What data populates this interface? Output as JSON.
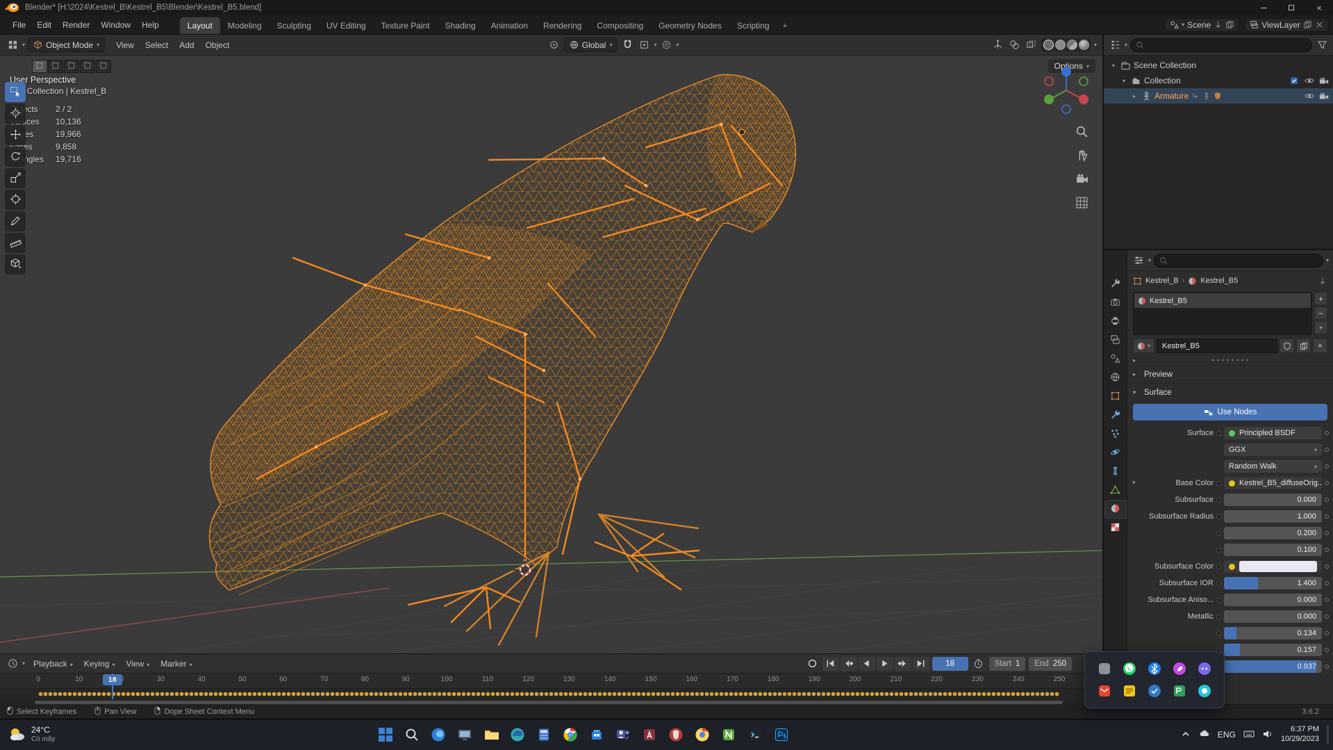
{
  "window": {
    "title": "Blender* [H:\\2024\\Kestrel_B\\Kestrel_B5\\Blender\\Kestrel_B5.blend]"
  },
  "menubar": {
    "menus": [
      "File",
      "Edit",
      "Render",
      "Window",
      "Help"
    ],
    "workspaces": [
      "Layout",
      "Modeling",
      "Sculpting",
      "UV Editing",
      "Texture Paint",
      "Shading",
      "Animation",
      "Rendering",
      "Compositing",
      "Geometry Nodes",
      "Scripting"
    ],
    "active_workspace": "Layout",
    "add_tab": "+",
    "scene": "Scene",
    "view_layer": "ViewLayer"
  },
  "viewport": {
    "mode": "Object Mode",
    "menus": [
      "View",
      "Select",
      "Add",
      "Object"
    ],
    "orientation": "Global",
    "options_label": "Options",
    "tools": [
      "select-box",
      "cursor",
      "move",
      "rotate",
      "scale",
      "transform",
      "annotate",
      "measure",
      "add-cube"
    ],
    "select_modes": [
      "select-new",
      "select-extend",
      "select-subtract",
      "select-invert",
      "select-intersect"
    ],
    "overlay": {
      "perspective": "User Perspective",
      "context": "(18) Collection | Kestrel_B",
      "stats": [
        {
          "label": "Objects",
          "value": "2 / 2"
        },
        {
          "label": "Vertices",
          "value": "10,136"
        },
        {
          "label": "Edges",
          "value": "19,966"
        },
        {
          "label": "Faces",
          "value": "9,858"
        },
        {
          "label": "Triangles",
          "value": "19,716"
        }
      ]
    }
  },
  "outliner": {
    "rows": [
      {
        "label": "Scene Collection",
        "level": 0,
        "icon": "scene-collection",
        "disclosure": "▾",
        "checkbox": false,
        "right_icons": [],
        "after_icons": [],
        "active": false
      },
      {
        "label": "Collection",
        "level": 1,
        "icon": "collection",
        "disclosure": "▾",
        "checkbox": true,
        "right_icons": [
          "eye",
          "camera"
        ],
        "after_icons": [],
        "active": false
      },
      {
        "label": "Armature",
        "level": 2,
        "icon": "armature",
        "disclosure": "▸",
        "checkbox": false,
        "right_icons": [
          "eye",
          "camera"
        ],
        "after_icons": [
          "child",
          "pose",
          "shield"
        ],
        "active": true
      }
    ]
  },
  "properties": {
    "tabs": [
      "tool",
      "render",
      "output",
      "view-layer",
      "scene",
      "world",
      "object",
      "modifiers",
      "particles",
      "physics",
      "constraints",
      "data",
      "material",
      "texture"
    ],
    "active_tab": "material",
    "breadcrumb": [
      {
        "label": "Kestrel_B",
        "icon": "object"
      },
      {
        "label": "Kestrel_B5",
        "icon": "material"
      }
    ],
    "slots": [
      "Kestrel_B5"
    ],
    "name_value": "Kestrel_B5",
    "preview_label": "Preview",
    "surface_section_label": "Surface",
    "use_nodes_label": "Use Nodes",
    "surface_row_label": "Surface",
    "surface_shader": "Principled BSDF",
    "distribution": "GGX",
    "subsurface_method": "Random Walk",
    "rows": [
      {
        "label": "Base Color",
        "type": "texture",
        "value": "Kestrel_B5_diffuseOrig...",
        "expander": true,
        "fill": 0
      },
      {
        "label": "Subsurface",
        "type": "slider",
        "value": "0.000",
        "fill": 0
      },
      {
        "label": "Subsurface Radius",
        "type": "slider",
        "value": "1.000",
        "fill": 0
      },
      {
        "label": "",
        "type": "slider",
        "value": "0.200",
        "fill": 0
      },
      {
        "label": "",
        "type": "slider",
        "value": "0.100",
        "fill": 0
      },
      {
        "label": "Subsurface Color",
        "type": "color",
        "value": "",
        "swatch": "#eae7f3",
        "fill": 0
      },
      {
        "label": "Subsurface IOR",
        "type": "slider",
        "value": "1.400",
        "fill": 0.35
      },
      {
        "label": "Subsurface Aniso...",
        "type": "slider",
        "value": "0.000",
        "fill": 0
      },
      {
        "label": "Metallic",
        "type": "slider",
        "value": "0.000",
        "fill": 0
      },
      {
        "label": "",
        "type": "slider",
        "value": "0.134",
        "fill": 0.13
      },
      {
        "label": "",
        "type": "slider",
        "value": "0.157",
        "fill": 0.16
      },
      {
        "label": "",
        "type": "slider",
        "value": "0.937",
        "fill": 0.94
      }
    ]
  },
  "timeline": {
    "menus": [
      "Playback",
      "Keying",
      "View",
      "Marker"
    ],
    "current_frame": "18",
    "tick_frames": [
      0,
      10,
      20,
      30,
      40,
      50,
      60,
      70,
      80,
      90,
      100,
      110,
      120,
      130,
      140,
      150,
      160,
      170,
      180,
      190,
      200,
      210,
      220,
      230,
      240,
      250
    ],
    "start_label": "Start",
    "start_value": "1",
    "end_label": "End",
    "end_value": "250"
  },
  "statusbar": {
    "hints": [
      {
        "button": "left",
        "label": "Select Keyframes"
      },
      {
        "button": "middle",
        "label": "Pan View"
      },
      {
        "button": "right",
        "label": "Dope Sheet Context Menu"
      }
    ],
    "version": "3.6.2"
  },
  "taskbar": {
    "weather_temp": "24°C",
    "weather_desc": "Có mây",
    "apps": [
      "start",
      "search",
      "edge-round",
      "monitor",
      "file-explorer",
      "edge",
      "calculator",
      "chrome",
      "store",
      "teams",
      "access",
      "brave",
      "chrome-2",
      "notepadpp",
      "terminal",
      "photoshop"
    ],
    "tray": {
      "language": "ENG",
      "time": "6:37 PM",
      "date": "10/29/2023"
    }
  },
  "tray_popup": {
    "icons": [
      "gray-app",
      "whatsapp",
      "bluetooth",
      "paint",
      "discord",
      "mail",
      "notes",
      "blue-app",
      "green-app",
      "teal-app"
    ]
  }
}
